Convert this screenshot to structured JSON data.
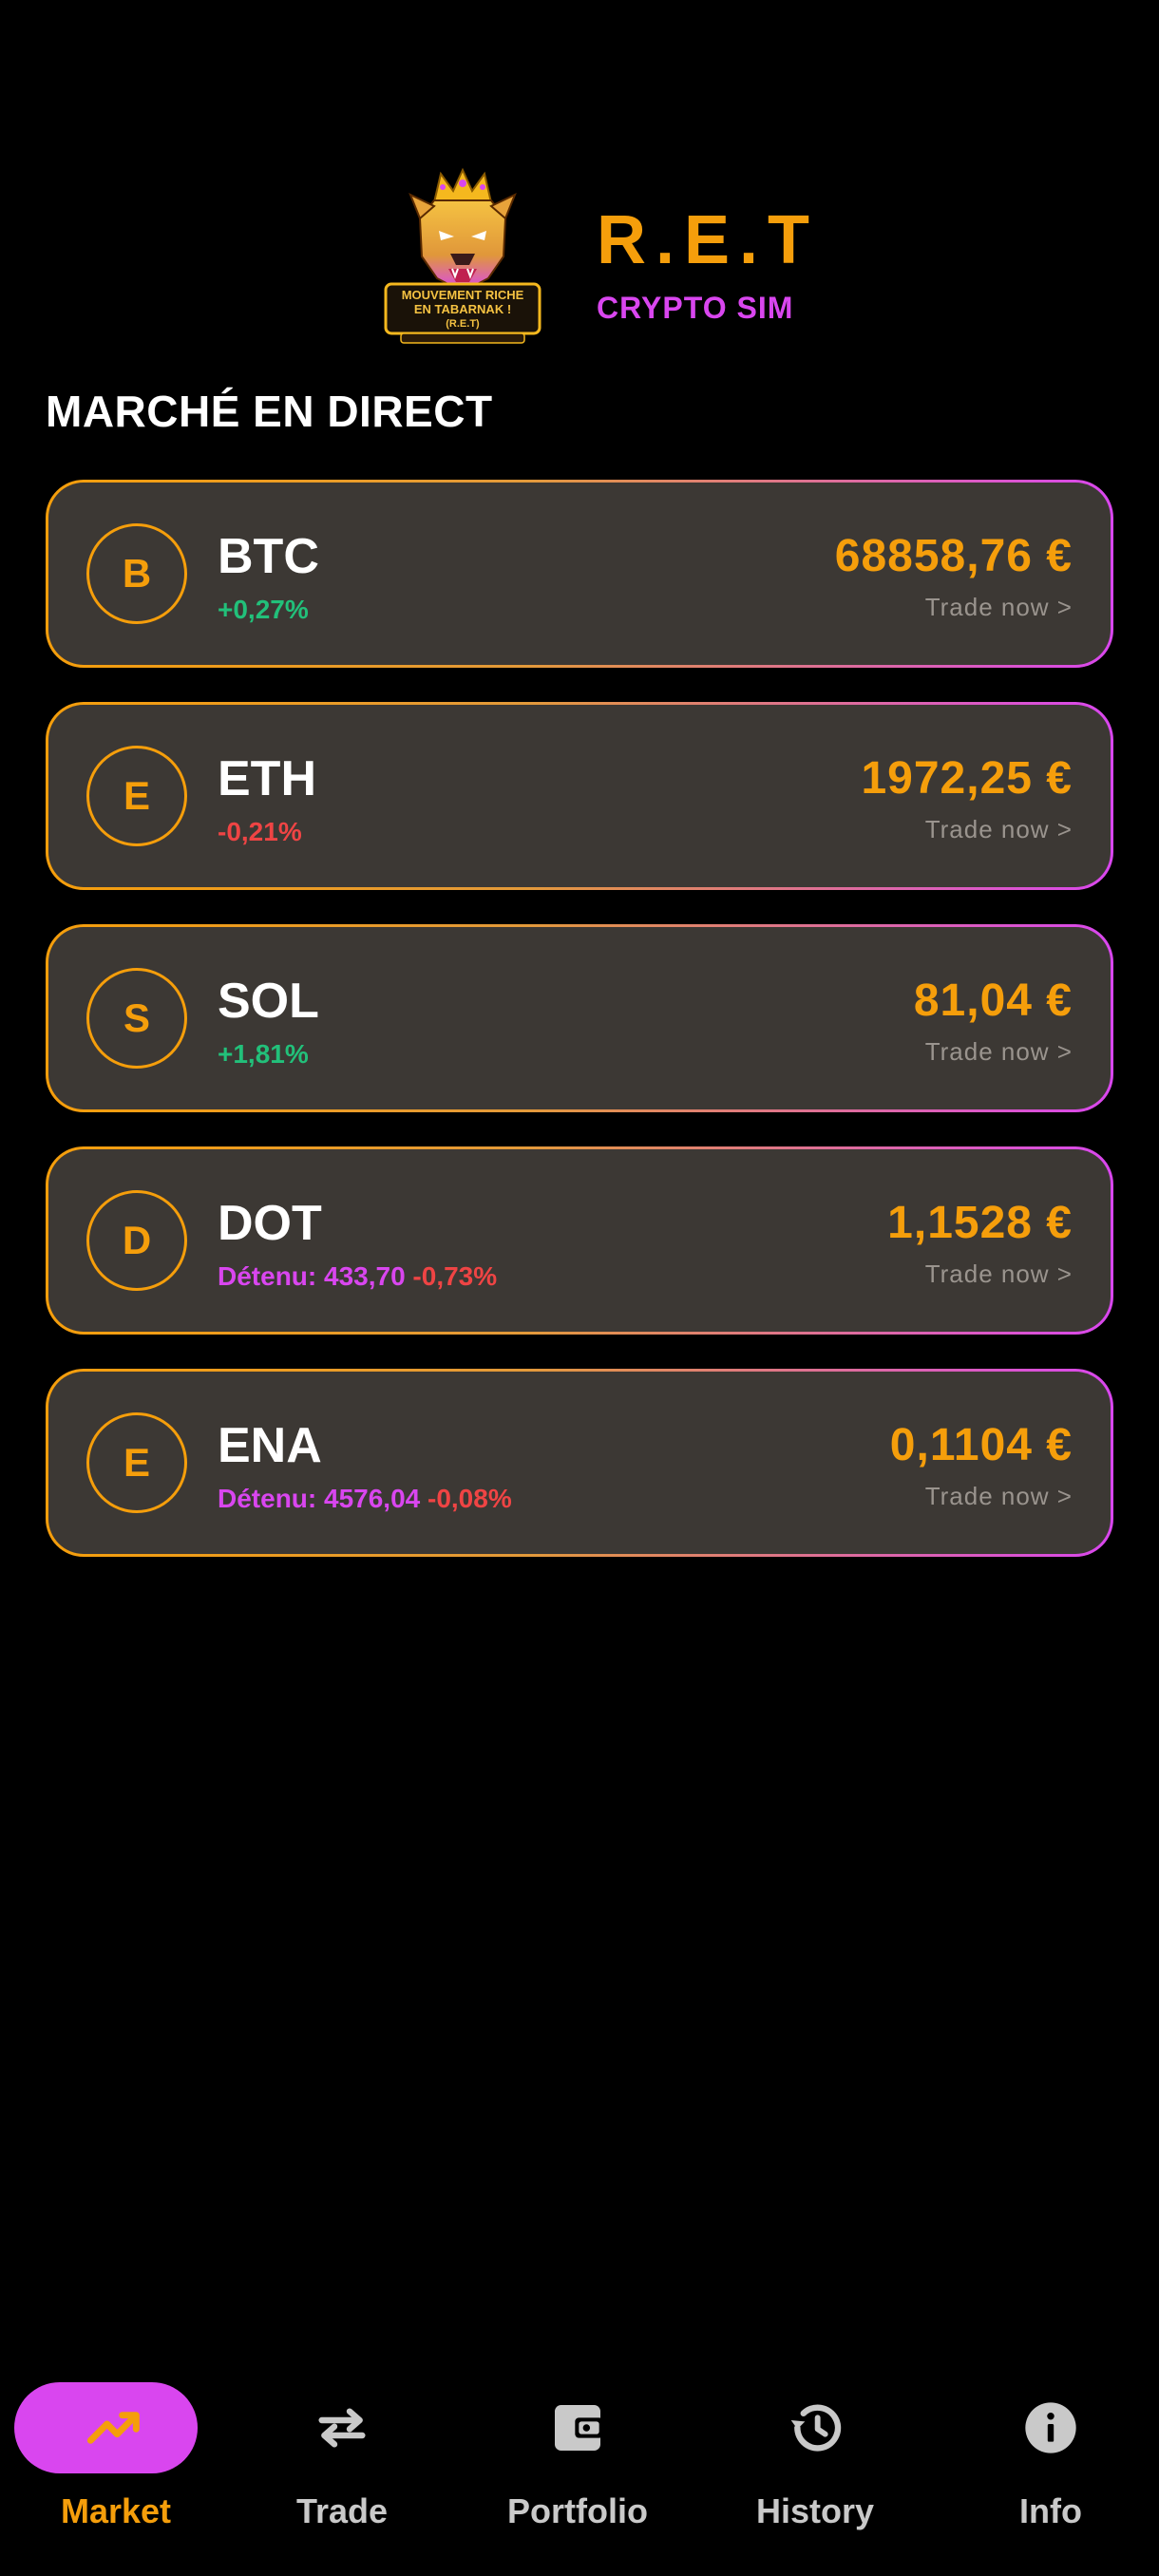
{
  "header": {
    "logo_text_line1": "MOUVEMENT RICHE",
    "logo_text_line2": "EN TABARNAK !",
    "logo_text_line3": "(R.E.T)",
    "brand_title": "R.E.T",
    "brand_subtitle": "CRYPTO SIM"
  },
  "market": {
    "section_title": "MARCHÉ EN DIRECT",
    "coins": [
      {
        "initial": "B",
        "symbol": "BTC",
        "held": "",
        "change": "+0,27%",
        "trend": "up",
        "price": "68858,76 €",
        "cta": "Trade now >"
      },
      {
        "initial": "E",
        "symbol": "ETH",
        "held": "",
        "change": "-0,21%",
        "trend": "down",
        "price": "1972,25 €",
        "cta": "Trade now >"
      },
      {
        "initial": "S",
        "symbol": "SOL",
        "held": "",
        "change": "+1,81%",
        "trend": "up",
        "price": "81,04 €",
        "cta": "Trade now >"
      },
      {
        "initial": "D",
        "symbol": "DOT",
        "held": "Détenu: 433,70",
        "change": "-0,73%",
        "trend": "down",
        "price": "1,1528 €",
        "cta": "Trade now >"
      },
      {
        "initial": "E",
        "symbol": "ENA",
        "held": "Détenu: 4576,04",
        "change": "-0,08%",
        "trend": "down",
        "price": "0,1104 €",
        "cta": "Trade now >"
      }
    ]
  },
  "nav": {
    "active": "market",
    "items": [
      {
        "key": "market",
        "label": "Market",
        "icon": "trending-up-icon"
      },
      {
        "key": "trade",
        "label": "Trade",
        "icon": "swap-arrows-icon"
      },
      {
        "key": "portfolio",
        "label": "Portfolio",
        "icon": "wallet-icon"
      },
      {
        "key": "history",
        "label": "History",
        "icon": "history-icon"
      },
      {
        "key": "info",
        "label": "Info",
        "icon": "info-icon"
      }
    ]
  },
  "colors": {
    "accent_orange": "#f59e0b",
    "accent_magenta": "#d946ef",
    "positive": "#22c07a",
    "negative": "#ef4444",
    "card_background": "#3c3834",
    "page_background": "#000000"
  }
}
